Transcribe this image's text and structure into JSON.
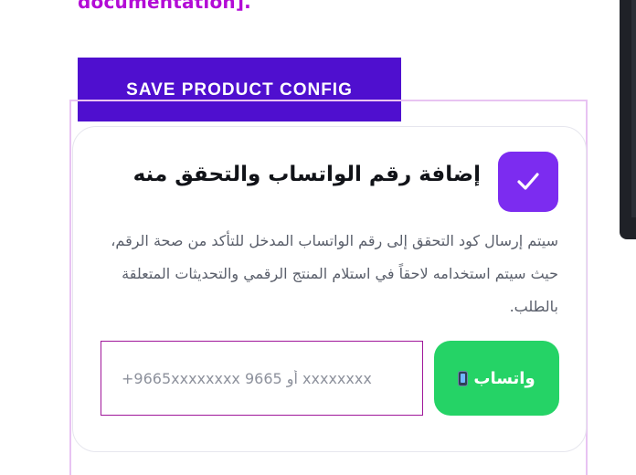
{
  "header": {
    "doc_link_text": "documentation]."
  },
  "toolbar": {
    "save_label": "SAVE PRODUCT CONFIG"
  },
  "card": {
    "title": "إضافة رقم الواتساب والتحقق منه",
    "check_glyph": "✓",
    "description": "سيتم إرسال كود التحقق إلى رقم الواتساب المدخل للتأكد من صحة الرقم، حيث سيتم استخدامه لاحقاً في استلام المنتج الرقمي والتحديثات المتعلقة بالطلب.",
    "phone_placeholder": "+9665xxxxxxxx أو 9665 xxxxxxxx",
    "whatsapp_button_label": "واتساب"
  },
  "colors": {
    "accent_purple": "#4f0fcf",
    "check_purple": "#7c2cf0",
    "link_magenta": "#b30bd6",
    "whatsapp_green": "#25d366",
    "frame_pink": "#e8c3f2"
  },
  "icons": {
    "check": "check-icon",
    "phone": "mobile-phone-icon"
  }
}
